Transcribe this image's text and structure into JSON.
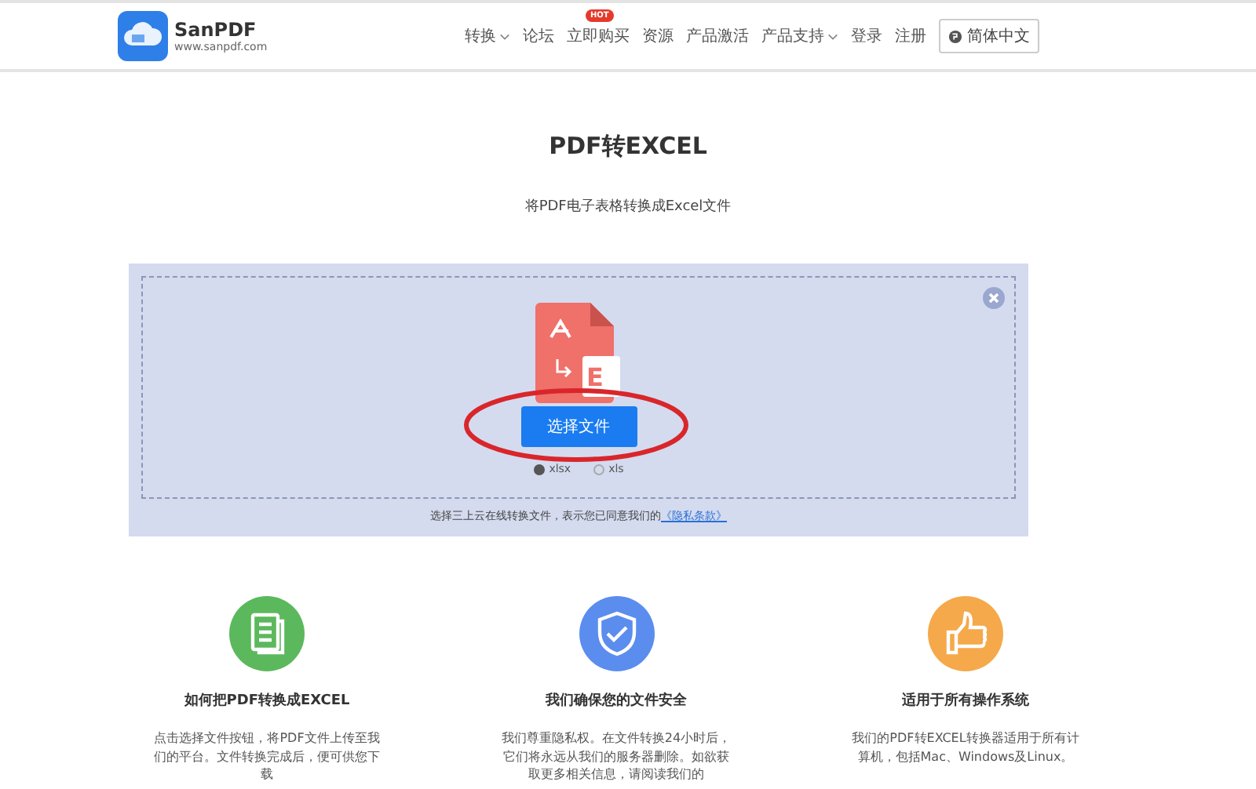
{
  "header": {
    "brand": "SanPDF",
    "url": "www.sanpdf.com",
    "nav": [
      {
        "label": "转换",
        "dropdown": true
      },
      {
        "label": "论坛",
        "dropdown": false
      },
      {
        "label": "立即购买",
        "dropdown": false,
        "badge": "HOT"
      },
      {
        "label": "资源",
        "dropdown": false
      },
      {
        "label": "产品激活",
        "dropdown": false
      },
      {
        "label": "产品支持",
        "dropdown": true
      },
      {
        "label": "登录",
        "dropdown": false
      },
      {
        "label": "注册",
        "dropdown": false
      }
    ],
    "language": "简体中文"
  },
  "title": "PDF转EXCEL",
  "subtitle": "将PDF电子表格转换成Excel文件",
  "upload": {
    "button": "选择文件",
    "icon_letter": "E",
    "formats": [
      {
        "label": "xlsx",
        "selected": true
      },
      {
        "label": "xls",
        "selected": false
      }
    ],
    "notice": "选择三上云在线转换文件，表示您已同意我们的",
    "privacy_link": "《隐私条款》"
  },
  "features": [
    {
      "kind": "document",
      "title": "如何把PDF转换成EXCEL",
      "text": "点击选择文件按钮，将PDF文件上传至我们的平台。文件转换完成后，便可供您下载"
    },
    {
      "kind": "shield",
      "title": "我们确保您的文件安全",
      "text": "我们尊重隐私权。在文件转换24小时后，它们将永远从我们的服务器删除。如欲获取更多相关信息，请阅读我们的"
    },
    {
      "kind": "thumb",
      "title": "适用于所有操作系统",
      "text": "我们的PDF转EXCEL转换器适用于所有计算机，包括Mac、Windows及Linux。"
    }
  ]
}
